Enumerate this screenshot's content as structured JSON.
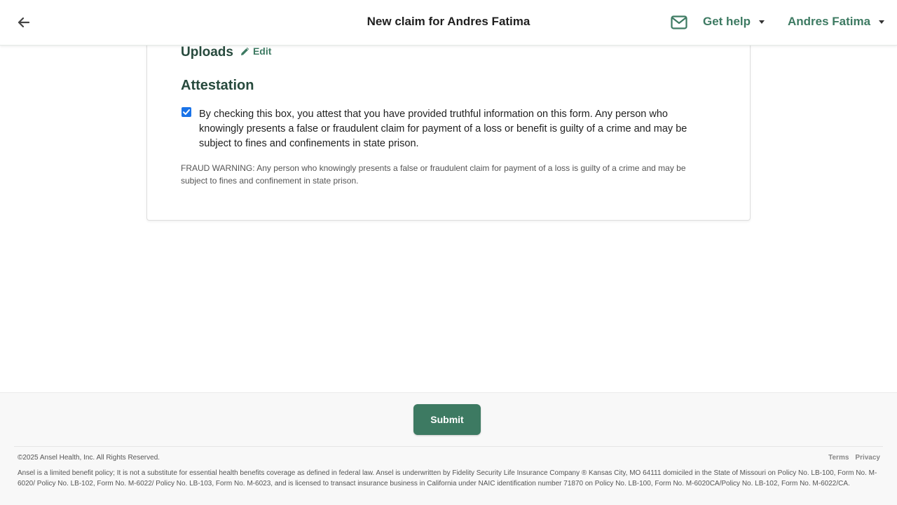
{
  "header": {
    "title": "New claim for Andres Fatima",
    "help_label": "Get help",
    "user_name": "Andres Fatima"
  },
  "review": {
    "uploads_heading": "Uploads",
    "edit_label": "Edit",
    "attestation_heading": "Attestation",
    "attestation_checked": true,
    "attestation_text": "By checking this box, you attest that you have provided truthful information on this form. Any person who knowingly presents a false or fraudulent claim for payment of a loss or benefit is guilty of a crime and may be subject to fines and confinements in state prison.",
    "fraud_warning": "FRAUD WARNING: Any person who knowingly presents a false or fraudulent claim for payment of a loss is guilty of a crime and may be subject to fines and confinement in state prison."
  },
  "actions": {
    "submit_label": "Submit"
  },
  "footer": {
    "copyright": "©2025 Ansel Health, Inc. All Rights Reserved.",
    "links": [
      "Terms",
      "Privacy"
    ],
    "disclaimer": "Ansel is a limited benefit policy; It is not a substitute for essential health benefits coverage as defined in federal law. Ansel is underwritten by Fidelity Security Life Insurance Company ® Kansas City, MO 64111 domiciled in the State of Missouri on Policy No. LB-100, Form No. M-6020/ Policy No. LB-102, Form No. M-6022/ Policy No. LB-103, Form No. M-6023, and is licensed to transact insurance business in California under NAIC identification number 71870 on Policy No. LB-100, Form No. M-6020CA/Policy No. LB-102, Form No. M-6022/CA."
  },
  "colors": {
    "brand_green": "#3d7a62",
    "heading_green": "#274a3d",
    "checkbox_blue": "#1a73e8"
  },
  "icons": {
    "back": "arrow-left-icon",
    "mail": "envelope-icon",
    "edit": "pencil-icon",
    "caret": "caret-down-icon"
  }
}
